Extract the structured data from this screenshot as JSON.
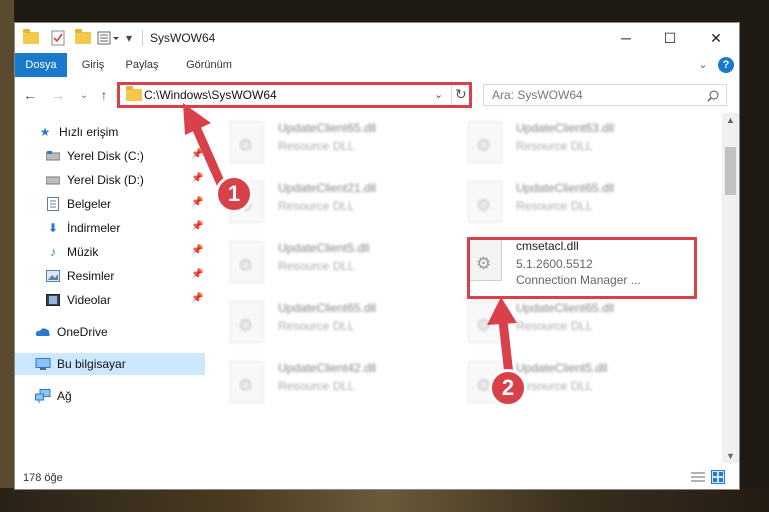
{
  "window": {
    "title": "SysWOW64",
    "minimize": "─",
    "maximize": "☐",
    "close": "✕"
  },
  "ribbon": {
    "tabs": [
      "Dosya",
      "Giriş",
      "Paylaş",
      "Görünüm"
    ],
    "collapse": "⌄",
    "help": "?"
  },
  "address": {
    "path": "C:\\Windows\\SysWOW64",
    "search_placeholder": "Ara: SysWOW64"
  },
  "sidebar": {
    "items": [
      {
        "label": "Hızlı erişim",
        "icon": "star-icon"
      },
      {
        "label": "Yerel Disk (C:)",
        "icon": "drive-icon"
      },
      {
        "label": "Yerel Disk (D:)",
        "icon": "drive-icon"
      },
      {
        "label": "Belgeler",
        "icon": "document-icon"
      },
      {
        "label": "İndirmeler",
        "icon": "download-icon"
      },
      {
        "label": "Müzik",
        "icon": "music-icon"
      },
      {
        "label": "Resimler",
        "icon": "pictures-icon"
      },
      {
        "label": "Videolar",
        "icon": "video-icon"
      },
      {
        "label": "OneDrive",
        "icon": "cloud-icon"
      },
      {
        "label": "Bu bilgisayar",
        "icon": "computer-icon"
      },
      {
        "label": "Ağ",
        "icon": "network-icon"
      }
    ]
  },
  "files": [
    {
      "name": "UpdateClient65.dll",
      "desc": "Resource DLL"
    },
    {
      "name": "UpdateClient63.dll",
      "desc": "Resource DLL"
    },
    {
      "name": "UpdateClient21.dll",
      "desc": "Resource DLL"
    },
    {
      "name": "UpdateClient65.dll",
      "desc": "Resource DLL"
    },
    {
      "name": "UpdateClient5.dll",
      "desc": "Resource DLL"
    },
    {
      "name": "cmsetacl.dll",
      "desc": "5.1.2600.5512",
      "desc2": "Connection Manager ..."
    },
    {
      "name": "UpdateClient65.dll",
      "desc": "Resource DLL"
    },
    {
      "name": "UpdateClient65.dll",
      "desc": "Resource DLL"
    },
    {
      "name": "UpdateClient42.dll",
      "desc": "Resource DLL"
    },
    {
      "name": "UpdateClient5.dll",
      "desc": "Resource DLL"
    }
  ],
  "status": {
    "count": "178 öğe"
  },
  "annotations": {
    "step1": "1",
    "step2": "2",
    "color": "#d9414a"
  }
}
